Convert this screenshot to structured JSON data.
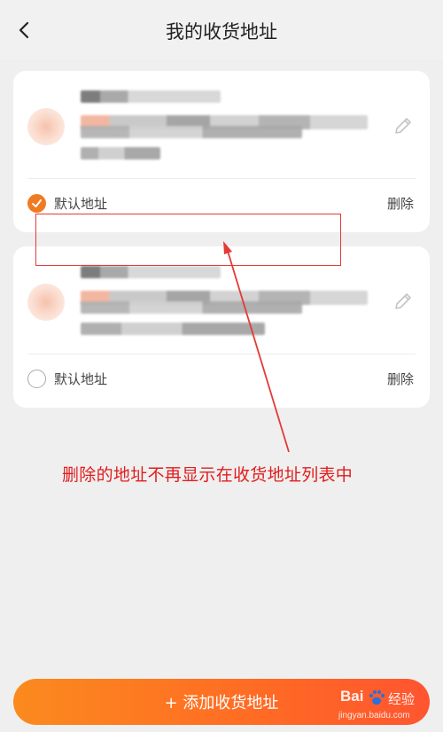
{
  "header": {
    "title": "我的收货地址",
    "back_icon": "chevron-left-icon"
  },
  "addresses": [
    {
      "default_label": "默认地址",
      "is_default": true,
      "delete_label": "删除",
      "edit_icon": "pencil-icon"
    },
    {
      "default_label": "默认地址",
      "is_default": false,
      "delete_label": "删除",
      "edit_icon": "pencil-icon"
    }
  ],
  "annotation": {
    "text": "删除的地址不再显示在收货地址列表中",
    "color": "#e11d1d"
  },
  "add_button": {
    "label": "+ 添加收货地址"
  },
  "watermark": {
    "brand": "Bai",
    "product": "经验",
    "url": "jingyan.baidu.com"
  },
  "colors": {
    "accent": "#f07a22",
    "button_start": "#fb8a1e",
    "button_end": "#ff5530",
    "background": "#efefef"
  }
}
